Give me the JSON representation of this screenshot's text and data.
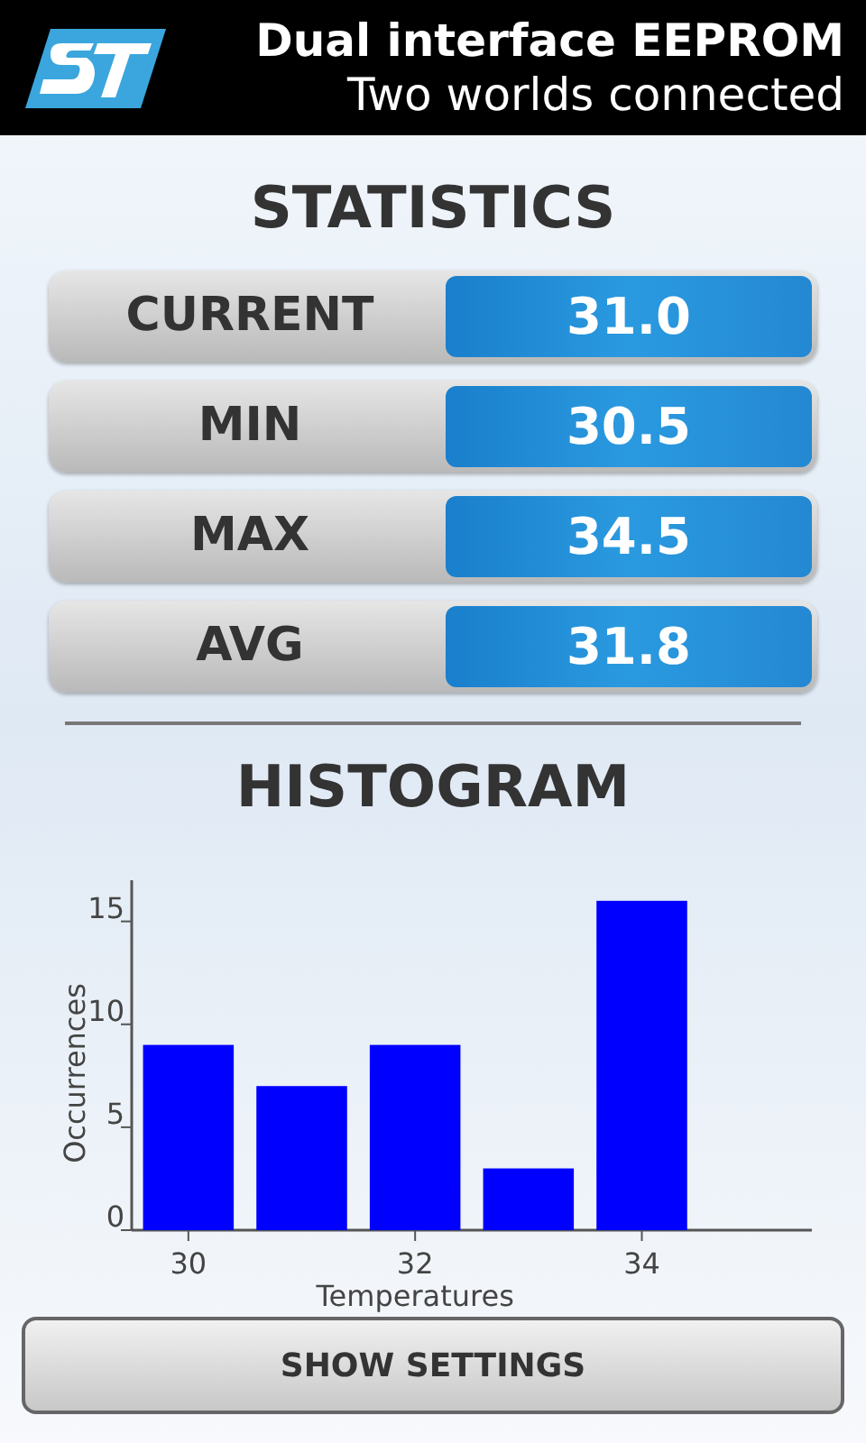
{
  "header": {
    "title": "Dual interface EEPROM",
    "subtitle": "Two worlds connected"
  },
  "statistics": {
    "title": "STATISTICS",
    "rows": [
      {
        "label": "CURRENT",
        "value": "31.0"
      },
      {
        "label": "MIN",
        "value": "30.5"
      },
      {
        "label": "MAX",
        "value": "34.5"
      },
      {
        "label": "AVG",
        "value": "31.8"
      }
    ]
  },
  "histogram": {
    "title": "HISTOGRAM",
    "chart_data": {
      "type": "bar",
      "xlabel": "Temperatures",
      "ylabel": "Occurrences",
      "x": [
        30,
        31,
        32,
        33,
        34
      ],
      "series": [
        {
          "color": "#0000ff",
          "values": [
            9,
            7,
            9,
            3,
            16
          ]
        }
      ],
      "xlim": [
        29.5,
        35.5
      ],
      "ylim": [
        0,
        17
      ],
      "xticks": [
        30,
        32,
        34
      ],
      "yticks": [
        0,
        5,
        10,
        15
      ]
    }
  },
  "button": "SHOW SETTINGS"
}
